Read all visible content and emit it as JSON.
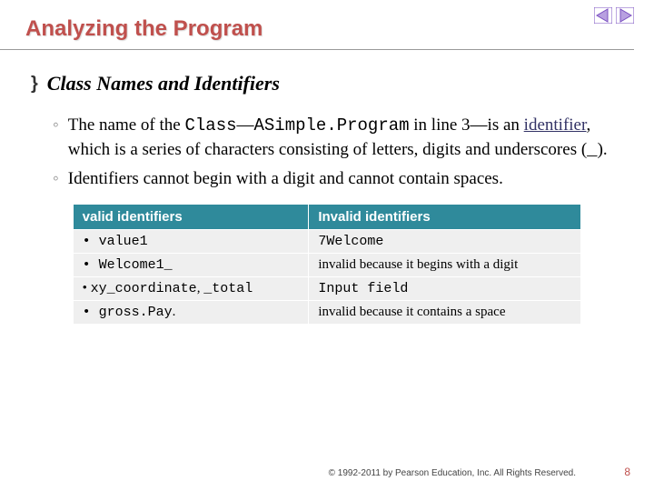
{
  "title": "Analyzing the Program",
  "heading": "Class Names and Identifiers",
  "bullet1_pre": "The name of the ",
  "bullet1_code1": "Class",
  "bullet1_mid1": "—",
  "bullet1_code2": "ASimple.Program",
  "bullet1_mid2": " in line 3—is an ",
  "bullet1_link": "identifier",
  "bullet1_post": ", which is a series of characters consisting of letters, digits and underscores (",
  "bullet1_under": "_",
  "bullet1_end": ").",
  "bullet2": "Identifiers cannot begin with a digit and cannot contain spaces.",
  "table": {
    "h1": "valid identifiers",
    "h2": "Invalid identifiers",
    "r1c1": "value1",
    "r1c2": "7Welcome",
    "r2c1": "Welcome1_",
    "r2c2": "invalid because it begins with a digit",
    "r3c1a": "xy_coordinate",
    "r3c1b": "_total",
    "r3c2": "Input field",
    "r4c1": "gross.Pay",
    "r4c2": "invalid because it contains a space"
  },
  "copyright": "© 1992-2011 by Pearson Education, Inc. All Rights Reserved.",
  "page": "8"
}
